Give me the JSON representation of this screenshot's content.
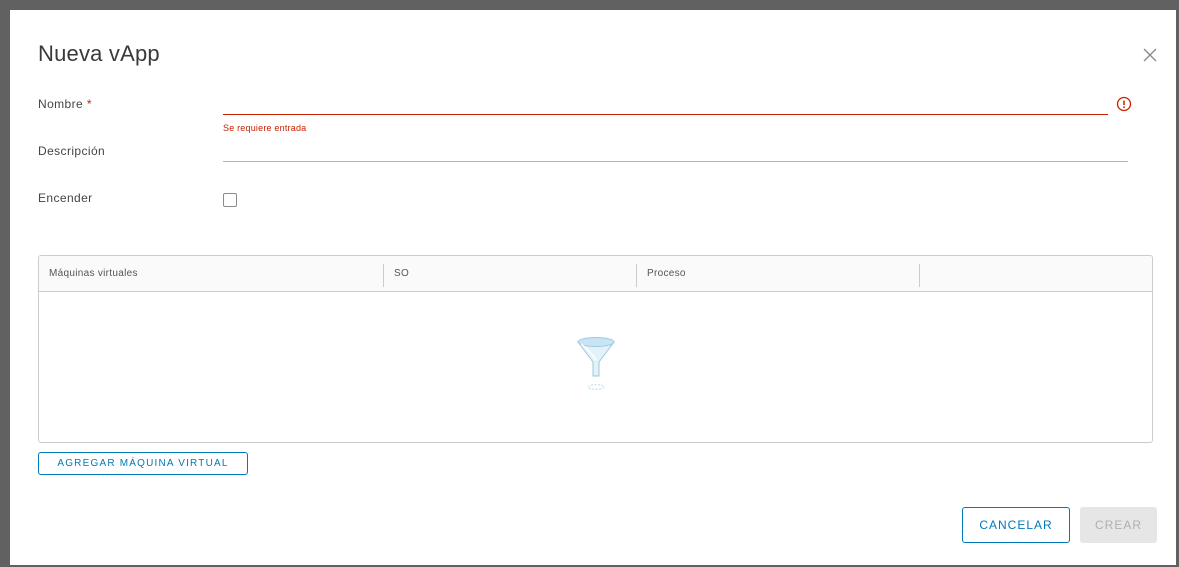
{
  "modal": {
    "title": "Nueva vApp",
    "close_icon": "close-icon"
  },
  "form": {
    "name": {
      "label": "Nombre",
      "required_marker": "*",
      "value": "",
      "error": "Se requiere entrada",
      "error_icon": "error-circle-icon"
    },
    "description": {
      "label": "Descripción",
      "value": ""
    },
    "power_on": {
      "label": "Encender",
      "checked": false
    }
  },
  "vm_grid": {
    "columns": [
      "Máquinas virtuales",
      "SO",
      "Proceso",
      ""
    ],
    "rows": [],
    "empty_icon": "filter-funnel-icon"
  },
  "buttons": {
    "add_vm": "AGREGAR MÁQUINA VIRTUAL",
    "cancel": "CANCELAR",
    "create": "CREAR"
  },
  "colors": {
    "accent": "#0079b8",
    "error": "#c92100",
    "disabled_bg": "#e6e6e6"
  }
}
